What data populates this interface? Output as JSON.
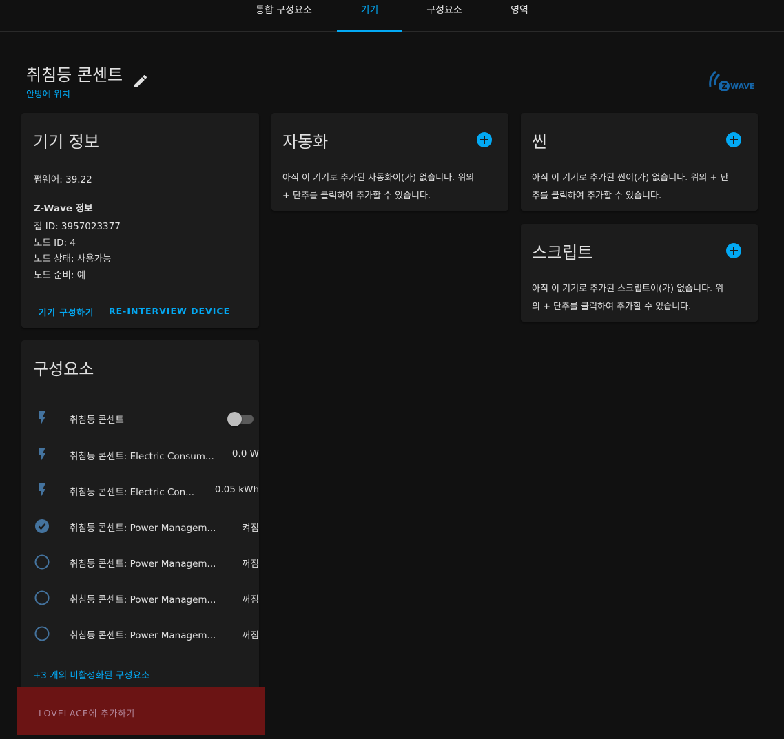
{
  "tabs": [
    {
      "label": "통합 구성요소",
      "active": false
    },
    {
      "label": "기기",
      "active": true
    },
    {
      "label": "구성요소",
      "active": false
    },
    {
      "label": "영역",
      "active": false
    }
  ],
  "device": {
    "name": "취침등 콘센트",
    "area": "안방에 위치",
    "logo_text": "WAVE"
  },
  "device_info": {
    "title": "기기 정보",
    "firmware": "펌웨어: 39.22",
    "zwave_heading": "Z-Wave 정보",
    "home_id": "집 ID: 3957023377",
    "node_id": "노드 ID: 4",
    "node_status": "노드 상태: 사용가능",
    "node_ready": "노드 준비: 예",
    "configure_label": "기기 구성하기",
    "reinterview_label": "RE-INTERVIEW DEVICE"
  },
  "automation": {
    "title": "자동화",
    "empty_line1": "아직 이 기기로 추가된 자동화이(가) 없습니다. 위의",
    "empty_line2": "+ 단추를 클릭하여 추가할 수 있습니다."
  },
  "scene": {
    "title": "씬",
    "empty_line1": "아직 이 기기로 추가된 씬이(가) 없습니다. 위의 + 단",
    "empty_line2": "추를 클릭하여 추가할 수 있습니다."
  },
  "script": {
    "title": "스크립트",
    "empty_line1": "아직 이 기기로 추가된 스크립트이(가) 없습니다. 위",
    "empty_line2": "의 + 단추를 클릭하여 추가할 수 있습니다."
  },
  "entities": {
    "title": "구성요소",
    "items": [
      {
        "name": "취침등 콘센트",
        "state": "",
        "icon": "flash-icon",
        "toggle": true
      },
      {
        "name": "취침등 콘센트: Electric Consum...",
        "state": "0.0 W",
        "icon": "flash-icon"
      },
      {
        "name": "취침등 콘센트: Electric Con...",
        "state": "0.05 kWh",
        "icon": "flash-icon"
      },
      {
        "name": "취침등 콘센트: Power Managem...",
        "state": "켜짐",
        "icon": "check-circle-icon"
      },
      {
        "name": "취침등 콘센트: Power Managem...",
        "state": "꺼짐",
        "icon": "circle-outline-icon"
      },
      {
        "name": "취침등 콘센트: Power Managem...",
        "state": "꺼짐",
        "icon": "circle-outline-icon"
      },
      {
        "name": "취침등 콘센트: Power Managem...",
        "state": "꺼짐",
        "icon": "circle-outline-icon"
      }
    ],
    "disabled_link": "+3 개의 비활성화된 구성요소",
    "lovelace_label": "LOVELACE에 추가하기"
  },
  "colors": {
    "accent": "#03a9f4",
    "background": "#111111",
    "card": "#1c1c1c",
    "icon": "#44739e",
    "highlight": "#6b1414"
  }
}
